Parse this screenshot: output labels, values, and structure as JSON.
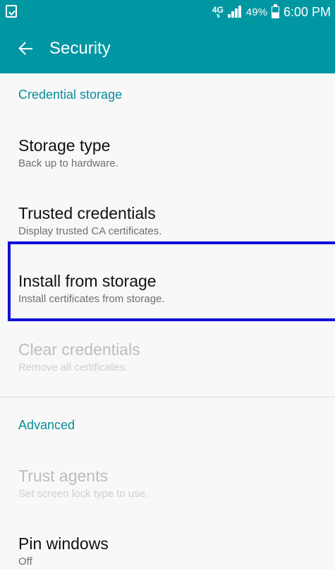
{
  "status_bar": {
    "network": "4G",
    "network_arrows": "⇅",
    "battery_percent": "49%",
    "battery_level": 0.49,
    "time": "6:00 PM"
  },
  "app_bar": {
    "title": "Security"
  },
  "sections": {
    "credential_storage": "Credential storage",
    "advanced": "Advanced"
  },
  "items": {
    "storage_type": {
      "title": "Storage type",
      "subtitle": "Back up to hardware.",
      "enabled": true
    },
    "trusted_credentials": {
      "title": "Trusted credentials",
      "subtitle": "Display trusted CA certificates.",
      "enabled": true
    },
    "install_from_storage": {
      "title": "Install from storage",
      "subtitle": "Install certificates from storage.",
      "enabled": true,
      "highlighted": true
    },
    "clear_credentials": {
      "title": "Clear credentials",
      "subtitle": "Remove all certificates.",
      "enabled": false
    },
    "trust_agents": {
      "title": "Trust agents",
      "subtitle": "Set screen lock type to use.",
      "enabled": false
    },
    "pin_windows": {
      "title": "Pin windows",
      "subtitle": "Off",
      "enabled": true
    }
  },
  "colors": {
    "accent": "#0097a3",
    "section_text": "#0a8d9a",
    "highlight_border": "#1010d8"
  },
  "icons": {
    "status_left": "screenshot-notification-icon",
    "back": "arrow-left-icon",
    "signal": "signal-bars-icon",
    "battery": "battery-icon"
  }
}
